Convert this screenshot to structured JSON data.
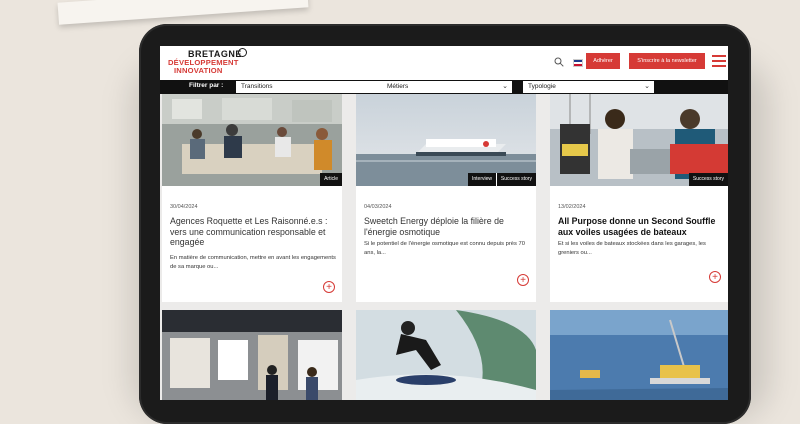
{
  "brand": {
    "line1": "BRETAGNE",
    "line2": "DÉVELOPPEMENT",
    "line3": "INNOVATION",
    "color": "#d63a36"
  },
  "header": {
    "adherer_label": "Adhérer",
    "newsletter_label": "S'inscrire à la newsletter"
  },
  "filters": {
    "label": "Filtrer par :",
    "transitions": "Transitions",
    "metiers": "Métiers",
    "typologie": "Typologie"
  },
  "cards": [
    {
      "tags": [
        "Article"
      ],
      "date": "30/04/2024",
      "title": "Agences Roquette et Les Raisonné.e.s : vers une communication responsable et engagée",
      "excerpt": "En matière de communication, mettre en avant les engagements de sa marque ou...",
      "bold": false
    },
    {
      "tags": [
        "Interview",
        "Success story"
      ],
      "date": "04/03/2024",
      "title": "Sweetch Energy déploie la filière de l'énergie osmotique",
      "excerpt": "Si le potentiel de l'énergie osmotique est connu depuis près 70 ans, la...",
      "bold": false
    },
    {
      "tags": [
        "Success story"
      ],
      "date": "13/02/2024",
      "title": "All Purpose donne un Second Souffle aux voiles usagées de bateaux",
      "excerpt": "Et si les voiles de bateaux stockées dans les garages, les greniers ou...",
      "bold": true
    }
  ],
  "icons": {
    "search": "search-icon",
    "flag": "flag-icon",
    "menu": "hamburger-menu-icon",
    "plus": "plus-icon",
    "chevron": "chevron-down-icon"
  }
}
